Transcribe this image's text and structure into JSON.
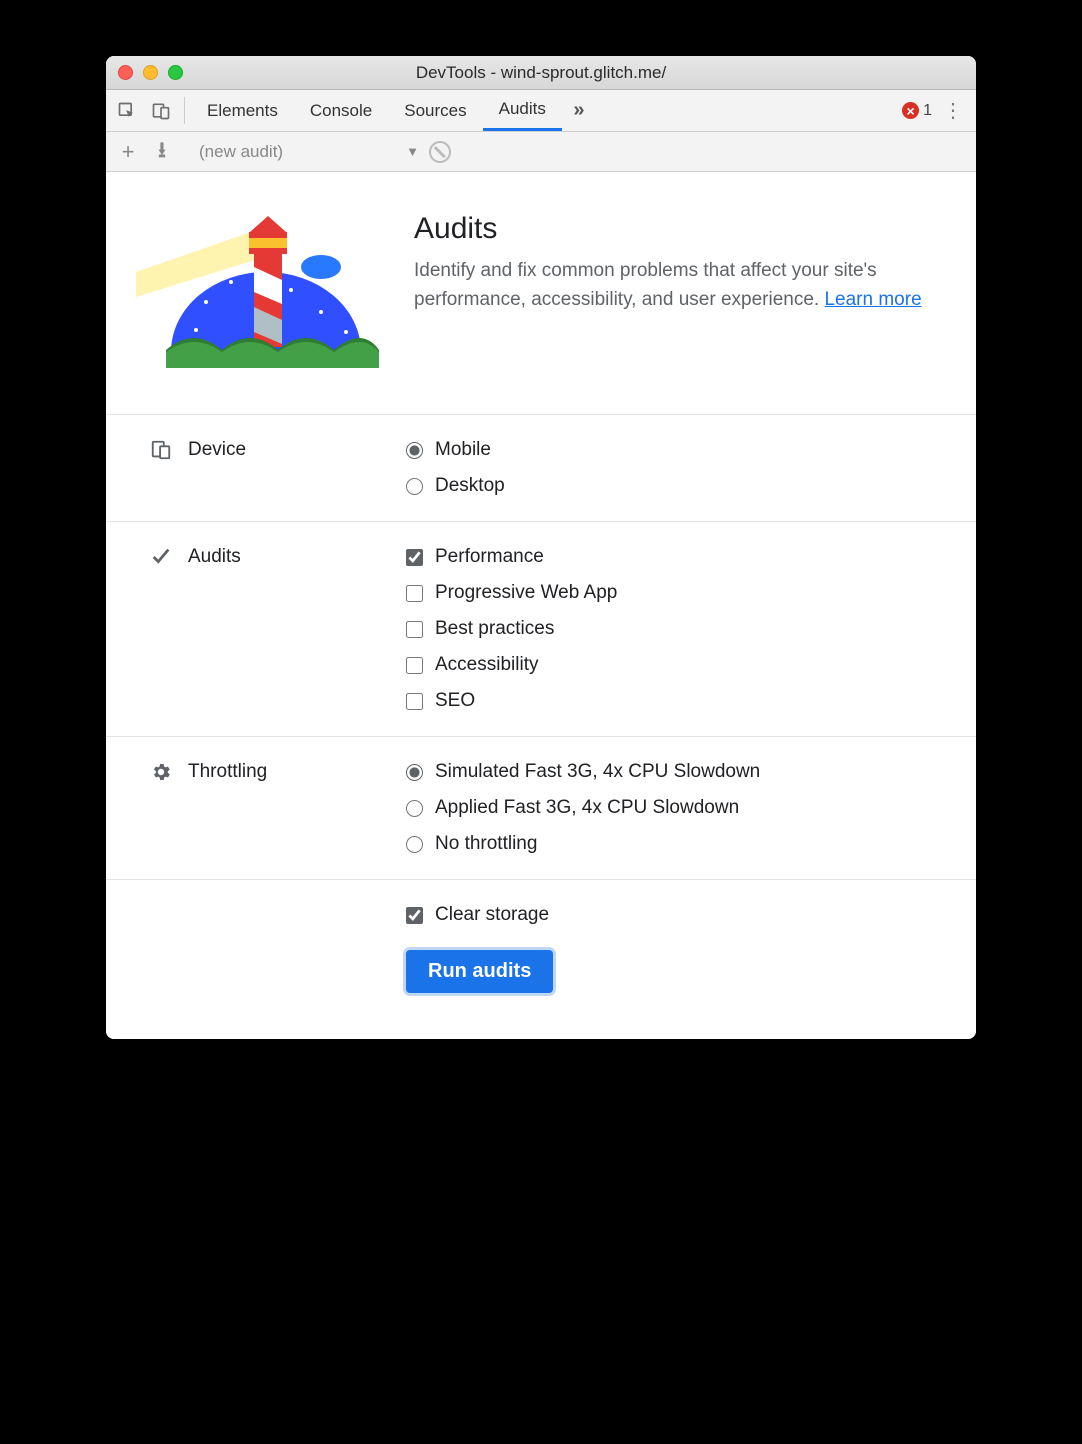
{
  "window": {
    "title": "DevTools - wind-sprout.glitch.me/"
  },
  "tabs": {
    "items": [
      "Elements",
      "Console",
      "Sources",
      "Audits"
    ],
    "active_index": 3,
    "error_count": "1"
  },
  "subtoolbar": {
    "audit_select": "(new audit)"
  },
  "hero": {
    "title": "Audits",
    "desc": "Identify and fix common problems that affect your site's performance, accessibility, and user experience. ",
    "learn_more": "Learn more"
  },
  "sections": {
    "device": {
      "label": "Device",
      "options": [
        {
          "label": "Mobile",
          "checked": true
        },
        {
          "label": "Desktop",
          "checked": false
        }
      ]
    },
    "audits": {
      "label": "Audits",
      "options": [
        {
          "label": "Performance",
          "checked": true
        },
        {
          "label": "Progressive Web App",
          "checked": false
        },
        {
          "label": "Best practices",
          "checked": false
        },
        {
          "label": "Accessibility",
          "checked": false
        },
        {
          "label": "SEO",
          "checked": false
        }
      ]
    },
    "throttling": {
      "label": "Throttling",
      "options": [
        {
          "label": "Simulated Fast 3G, 4x CPU Slowdown",
          "checked": true
        },
        {
          "label": "Applied Fast 3G, 4x CPU Slowdown",
          "checked": false
        },
        {
          "label": "No throttling",
          "checked": false
        }
      ]
    },
    "clear_storage": {
      "label": "Clear storage",
      "checked": true
    }
  },
  "run_button": "Run audits"
}
